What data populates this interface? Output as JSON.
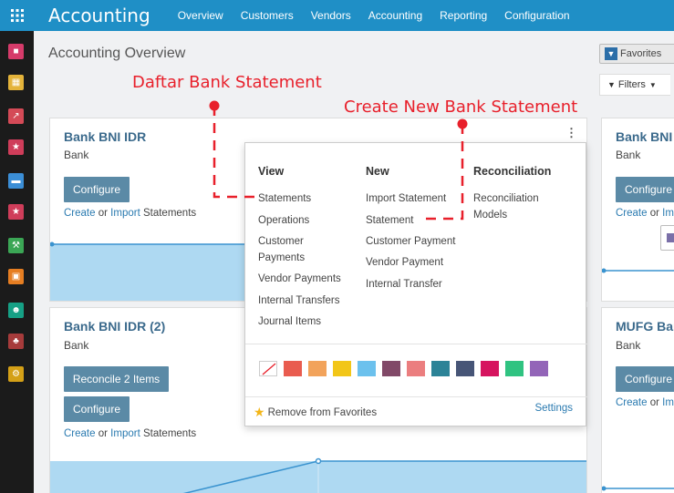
{
  "navbar": {
    "app_title": "Accounting",
    "menu": [
      "Overview",
      "Customers",
      "Vendors",
      "Accounting",
      "Reporting",
      "Configuration"
    ]
  },
  "sidebar": {
    "icons": [
      {
        "name": "discuss-icon",
        "color": "#d63b6a"
      },
      {
        "name": "calendar-icon",
        "color": "#e4b33a"
      },
      {
        "name": "crm-icon",
        "color": "#d44a57"
      },
      {
        "name": "sales-icon",
        "color": "#cf3d5a"
      },
      {
        "name": "invoicing-icon",
        "color": "#3b8ed6"
      },
      {
        "name": "accounting-icon",
        "color": "#cf3d5a"
      },
      {
        "name": "tools-icon",
        "color": "#3ba655"
      },
      {
        "name": "documents-icon",
        "color": "#e67e22"
      },
      {
        "name": "employees-icon",
        "color": "#16a085"
      },
      {
        "name": "apps-icon",
        "color": "#a63b3b"
      },
      {
        "name": "settings-icon",
        "color": "#d4a017"
      }
    ]
  },
  "page": {
    "title": "Accounting Overview",
    "favorites_label": "Favorites",
    "filters_label": "Filters"
  },
  "cards": [
    {
      "name": "Bank BNI IDR",
      "type": "Bank",
      "configure_label": "Configure",
      "create_label": "Create",
      "or_label": "or",
      "import_label": "Import",
      "statements_label": "Statements"
    },
    {
      "name": "Bank BNI IDR (2)",
      "type": "Bank",
      "reconcile_label": "Reconcile 2 Items",
      "configure_label": "Configure",
      "create_label": "Create",
      "or_label": "or",
      "import_label": "Import",
      "statements_label": "Statements"
    },
    {
      "name": "Bank BNI",
      "type": "Bank",
      "configure_label": "Configure",
      "create_label": "Create",
      "or_label": "or",
      "import_label": "Im"
    },
    {
      "name": "MUFG Bar",
      "type": "Bank",
      "configure_label": "Configure",
      "create_label": "Create",
      "or_label": "or",
      "import_label": "Im"
    }
  ],
  "dropdown": {
    "view_header": "View",
    "view_items": [
      "Statements",
      "Operations",
      "Customer",
      "Payments",
      "Vendor Payments",
      "Internal Transfers",
      "Journal Items"
    ],
    "new_header": "New",
    "new_items": [
      "Import Statement",
      "Statement",
      "Customer Payment",
      "Vendor Payment",
      "Internal Transfer"
    ],
    "reconciliation_header": "Reconciliation",
    "reconciliation_items": [
      "Reconciliation",
      "Models"
    ],
    "colors": [
      "#e95c4f",
      "#f2a35b",
      "#f2c618",
      "#6cc1ed",
      "#814968",
      "#eb7e7f",
      "#2c8397",
      "#475577",
      "#d6145f",
      "#30c381",
      "#9365b8"
    ],
    "remove_favorites_label": "Remove from Favorites",
    "settings_label": "Settings"
  },
  "annotations": {
    "daftar_label": "Daftar Bank Statement",
    "create_label": "Create New Bank Statement",
    "color": "#e8202b"
  }
}
